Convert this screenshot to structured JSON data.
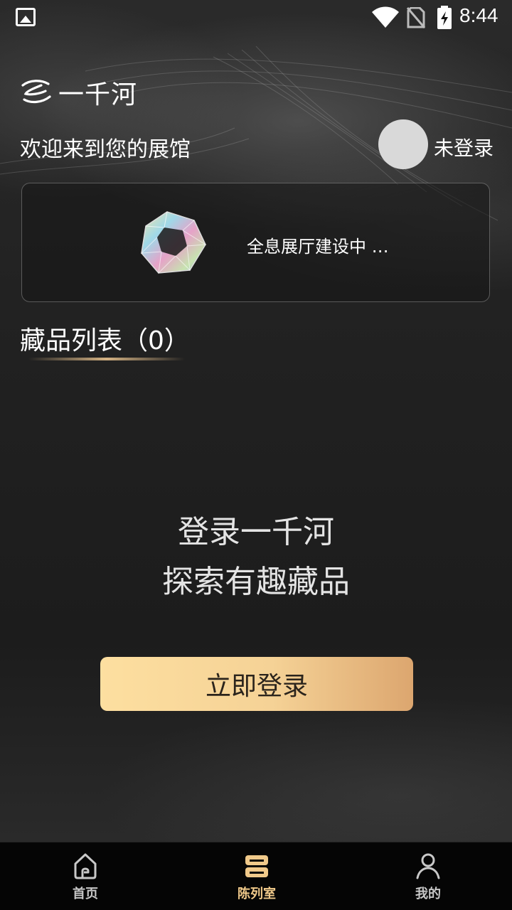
{
  "status_bar": {
    "time": "8:44",
    "icons": [
      "image-icon",
      "wifi-icon",
      "no-sim-icon",
      "battery-charging-icon"
    ]
  },
  "header": {
    "app_name": "一千河",
    "logo_icon": "river-logo-icon",
    "welcome": "欢迎来到您的展馆",
    "login_status": "未登录"
  },
  "hologram": {
    "text": "全息展厅建设中 …"
  },
  "collection": {
    "title": "藏品列表（0）",
    "empty_line1": "登录一千河",
    "empty_line2": "探索有趣藏品",
    "login_button": "立即登录"
  },
  "tabbar": {
    "items": [
      {
        "label": "首页",
        "icon": "home-icon",
        "active": false
      },
      {
        "label": "陈列室",
        "icon": "showcase-icon",
        "active": true
      },
      {
        "label": "我的",
        "icon": "person-icon",
        "active": false
      }
    ],
    "active_color": "#f0c98a",
    "inactive_color": "#c8c8c8"
  },
  "colors": {
    "button_gradient_start": "#fddfa0",
    "button_gradient_end": "#dca66f",
    "background": "#1c1c1c"
  }
}
